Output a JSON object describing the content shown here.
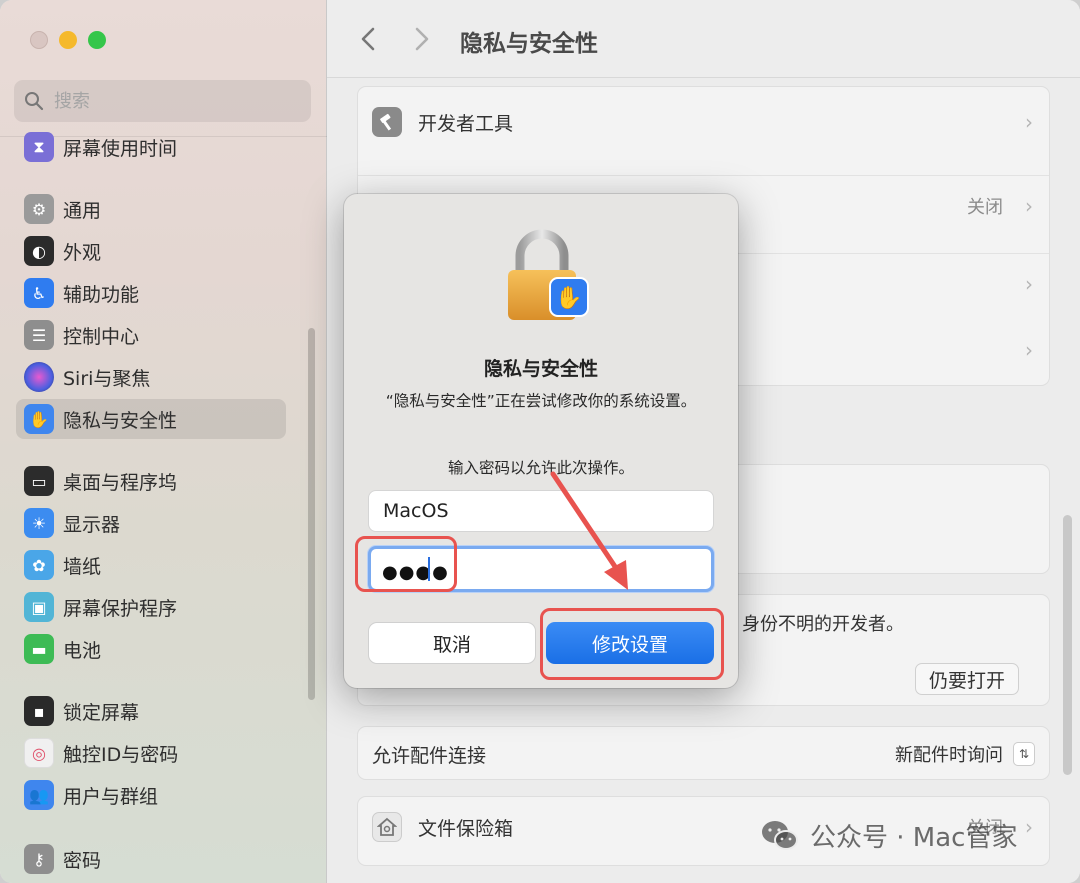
{
  "search": {
    "placeholder": "搜索"
  },
  "sidebar": {
    "items": [
      {
        "label": "屏幕使用时间",
        "icon": "hourglass-icon",
        "color": "#7a6fd6"
      },
      {
        "label": "通用",
        "icon": "gear-icon",
        "color": "#9a9a9a"
      },
      {
        "label": "外观",
        "icon": "appearance-icon",
        "color": "#2b2b2b"
      },
      {
        "label": "辅助功能",
        "icon": "accessibility-icon",
        "color": "#2f7cf0"
      },
      {
        "label": "控制中心",
        "icon": "control-center-icon",
        "color": "#8e8e8e"
      },
      {
        "label": "Siri与聚焦",
        "icon": "siri-icon",
        "color": "#6a5ec9"
      },
      {
        "label": "隐私与安全性",
        "icon": "hand-icon",
        "color": "#3f86ee"
      },
      {
        "label": "桌面与程序坞",
        "icon": "dock-icon",
        "color": "#2c2c2c"
      },
      {
        "label": "显示器",
        "icon": "sun-icon",
        "color": "#3c8cf0"
      },
      {
        "label": "墙纸",
        "icon": "flower-icon",
        "color": "#4aa6e8"
      },
      {
        "label": "屏幕保护程序",
        "icon": "screensaver-icon",
        "color": "#52b5d6"
      },
      {
        "label": "电池",
        "icon": "battery-icon",
        "color": "#3dbb55"
      },
      {
        "label": "锁定屏幕",
        "icon": "lock-screen-icon",
        "color": "#2a2a2a"
      },
      {
        "label": "触控ID与密码",
        "icon": "fingerprint-icon",
        "color": "#f0f0f0"
      },
      {
        "label": "用户与群组",
        "icon": "users-icon",
        "color": "#3f86ee"
      },
      {
        "label": "密码",
        "icon": "key-icon",
        "color": "#8e8e8e"
      }
    ]
  },
  "toolbar": {
    "title": "隐私与安全性",
    "back_icon": "chevron-left-icon",
    "forward_icon": "chevron-right-icon"
  },
  "main": {
    "developer_tools": "开发者工具",
    "row2_value": "关闭",
    "unknown_developer": "身份不明的开发者。",
    "open_anyway": "仍要打开",
    "accessory_label": "允许配件连接",
    "accessory_value": "新配件时询问",
    "filevault_label": "文件保险箱",
    "filevault_value": "关闭"
  },
  "dialog": {
    "title": "隐私与安全性",
    "message": "“隐私与安全性”正在尝试修改你的系统设置。",
    "prompt": "输入密码以允许此次操作。",
    "username_value": "MacOS",
    "password_dots": "●●●●",
    "cancel_label": "取消",
    "confirm_label": "修改设置"
  },
  "watermark": {
    "text": "公众号 · Mac管家"
  },
  "colors": {
    "accent": "#1a6fe6",
    "highlight": "#e8534f"
  }
}
